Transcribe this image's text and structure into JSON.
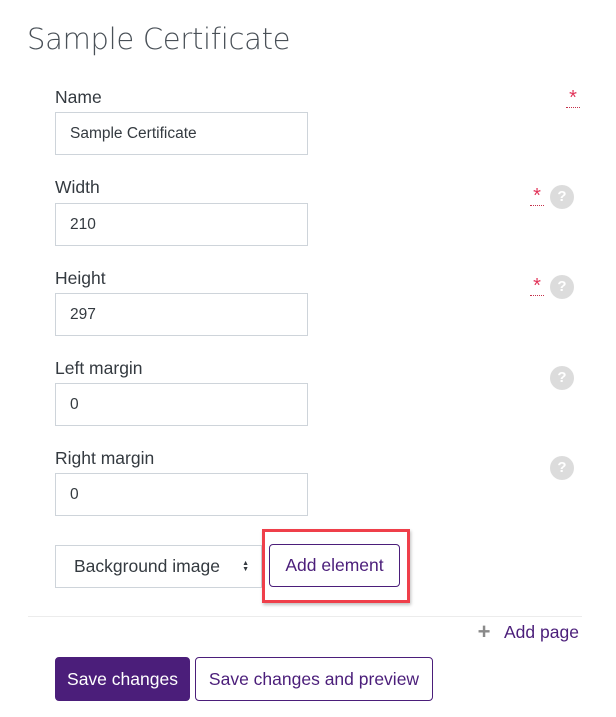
{
  "page": {
    "title": "Sample Certificate"
  },
  "fields": [
    {
      "label": "Name",
      "value": "Sample Certificate",
      "required": true,
      "help": false
    },
    {
      "label": "Width",
      "value": "210",
      "required": true,
      "help": true
    },
    {
      "label": "Height",
      "value": "297",
      "required": true,
      "help": true
    },
    {
      "label": "Left margin",
      "value": "0",
      "required": false,
      "help": true
    },
    {
      "label": "Right margin",
      "value": "0",
      "required": false,
      "help": true
    }
  ],
  "icons": {
    "required": "*",
    "help": "?",
    "plus": "+",
    "select_arrow_up": "▲",
    "select_arrow_down": "▼"
  },
  "element_select": {
    "selected": "Background image"
  },
  "buttons": {
    "add_element": "Add element",
    "add_page": "Add page",
    "save_changes": "Save changes",
    "save_and_preview": "Save changes and preview"
  },
  "colors": {
    "brand": "#4b1e7a",
    "required": "#e2345a",
    "highlight": "#ef3f4a"
  }
}
